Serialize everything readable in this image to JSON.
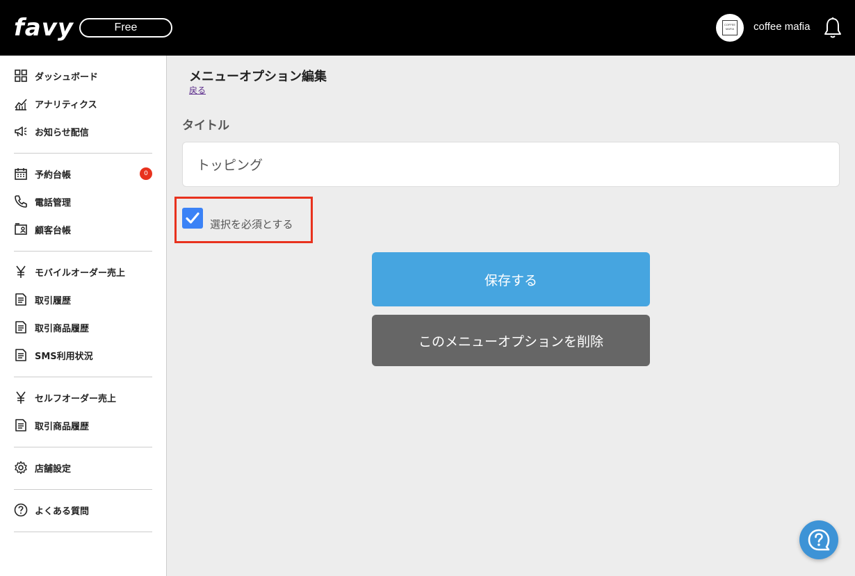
{
  "header": {
    "logo": "favy",
    "plan": "Free",
    "avatar_text": "COFFEE MAFIA",
    "username": "coffee mafia"
  },
  "sidebar": {
    "items": [
      {
        "label": "ダッシュボード",
        "icon": "grid-icon"
      },
      {
        "label": "アナリティクス",
        "icon": "chart-icon"
      },
      {
        "label": "お知らせ配信",
        "icon": "megaphone-icon"
      },
      {
        "label": "予約台帳",
        "icon": "calendar-icon",
        "badge": "0"
      },
      {
        "label": "電話管理",
        "icon": "phone-icon"
      },
      {
        "label": "顧客台帳",
        "icon": "contact-icon"
      },
      {
        "label": "モバイルオーダー売上",
        "icon": "yen-icon"
      },
      {
        "label": "取引履歴",
        "icon": "document-icon"
      },
      {
        "label": "取引商品履歴",
        "icon": "document-icon"
      },
      {
        "label": "SMS利用状況",
        "icon": "document-icon"
      },
      {
        "label": "セルフオーダー売上",
        "icon": "yen-icon"
      },
      {
        "label": "取引商品履歴",
        "icon": "document-icon"
      },
      {
        "label": "店舗設定",
        "icon": "gear-icon"
      },
      {
        "label": "よくある質問",
        "icon": "question-icon"
      }
    ]
  },
  "main": {
    "title": "メニューオプション編集",
    "back": "戻る",
    "field_label": "タイトル",
    "title_value": "トッピング",
    "required_label": "選択を必須とする",
    "required_checked": true,
    "save_button": "保存する",
    "delete_button": "このメニューオプションを削除"
  },
  "colors": {
    "header_bg": "#000000",
    "save": "#46a5e0",
    "delete": "#666666",
    "checkbox": "#3b82f6",
    "highlight": "#e8321e",
    "badge": "#e8321e"
  }
}
